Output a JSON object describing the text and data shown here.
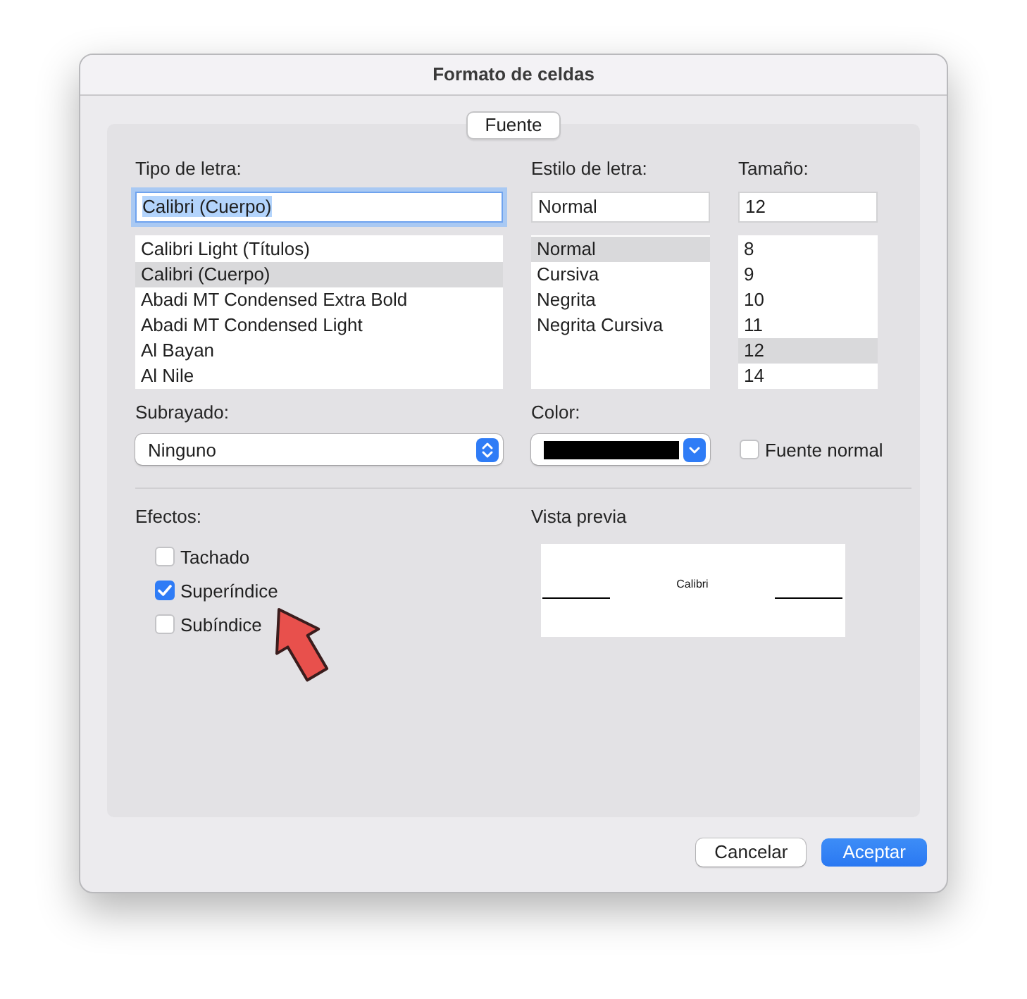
{
  "window": {
    "title": "Formato de celdas"
  },
  "tabs": [
    {
      "label": "Fuente",
      "selected": true
    }
  ],
  "font": {
    "label": "Tipo de letra:",
    "value": "Calibri (Cuerpo)",
    "focused": true,
    "items": [
      {
        "label": "Calibri Light (Títulos)",
        "selected": false
      },
      {
        "label": "Calibri (Cuerpo)",
        "selected": true
      },
      {
        "label": "Abadi MT Condensed Extra Bold",
        "selected": false
      },
      {
        "label": "Abadi MT Condensed Light",
        "selected": false
      },
      {
        "label": "Al Bayan",
        "selected": false
      },
      {
        "label": "Al Nile",
        "selected": false
      }
    ]
  },
  "style": {
    "label": "Estilo de letra:",
    "value": "Normal",
    "items": [
      {
        "label": "Normal",
        "selected": true
      },
      {
        "label": "Cursiva",
        "selected": false
      },
      {
        "label": "Negrita",
        "selected": false
      },
      {
        "label": "Negrita Cursiva",
        "selected": false
      }
    ]
  },
  "size": {
    "label": "Tamaño:",
    "value": "12",
    "items": [
      {
        "label": "8",
        "selected": false
      },
      {
        "label": "9",
        "selected": false
      },
      {
        "label": "10",
        "selected": false
      },
      {
        "label": "11",
        "selected": false
      },
      {
        "label": "12",
        "selected": true
      },
      {
        "label": "14",
        "selected": false
      }
    ]
  },
  "underline": {
    "label": "Subrayado:",
    "value": "Ninguno"
  },
  "font_color": {
    "label": "Color:",
    "color": "#000000"
  },
  "normal_font": {
    "label": "Fuente normal",
    "checked": false
  },
  "effects": {
    "label": "Efectos:",
    "items": [
      {
        "label": "Tachado",
        "checked": false
      },
      {
        "label": "Superíndice",
        "checked": true
      },
      {
        "label": "Subíndice",
        "checked": false
      }
    ]
  },
  "preview": {
    "label": "Vista previa",
    "sample": "Calibri"
  },
  "buttons": [
    {
      "label": "Cancelar",
      "kind": "plain"
    },
    {
      "label": "Aceptar",
      "kind": "default"
    }
  ]
}
